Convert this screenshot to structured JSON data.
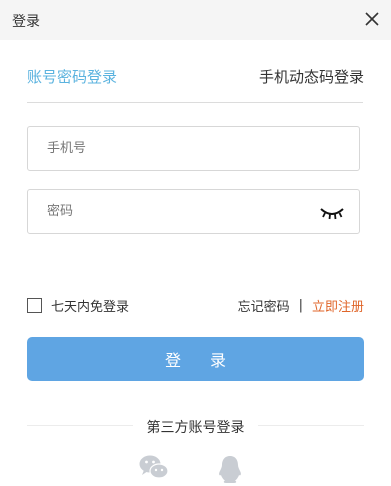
{
  "window": {
    "title": "登录"
  },
  "tabs": {
    "account": "账号密码登录",
    "phone": "手机动态码登录"
  },
  "fields": {
    "phone": {
      "placeholder": "手机号",
      "value": ""
    },
    "password": {
      "placeholder": "密码",
      "value": ""
    }
  },
  "options": {
    "remember_label": "七天内免登录",
    "forgot_label": "忘记密码",
    "separator": "|",
    "register_label": "立即注册"
  },
  "login_button": "登 录",
  "third_party": {
    "title": "第三方账号登录",
    "providers": [
      "wechat-icon",
      "qq-icon"
    ]
  },
  "colors": {
    "accent": "#5bb3df",
    "button": "#5fa5e3",
    "register": "#e0662a",
    "social_icon": "#c9cdd3"
  }
}
